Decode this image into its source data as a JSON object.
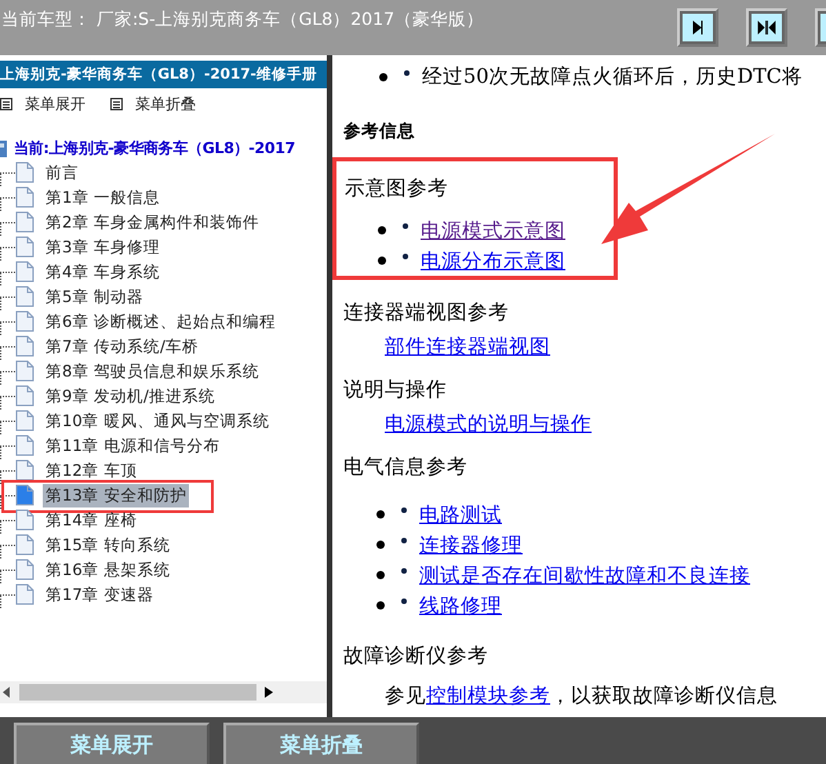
{
  "top_bar": {
    "title": "当前车型：  厂家:S-上海别克商务车（GL8）2017（豪华版）",
    "buttons": [
      {
        "kind": "right"
      },
      {
        "kind": "split"
      },
      {
        "kind": "edge"
      }
    ]
  },
  "sidebar": {
    "title": "上海别克-豪华商务车（GL8）-2017-维修手册",
    "actions": [
      "菜单展开",
      "菜单折叠"
    ],
    "tree": {
      "label": "当前:上海别克-豪华商务车（GL8）-2017",
      "expanded": true,
      "children": [
        {
          "label": "前言",
          "selected": false,
          "highlighted": false
        },
        {
          "label": "第1章 一般信息",
          "selected": false,
          "highlighted": false
        },
        {
          "label": "第2章 车身金属构件和装饰件",
          "selected": false,
          "highlighted": false
        },
        {
          "label": "第3章 车身修理",
          "selected": false,
          "highlighted": false
        },
        {
          "label": "第4章 车身系统",
          "selected": false,
          "highlighted": false
        },
        {
          "label": "第5章 制动器",
          "selected": false,
          "highlighted": false
        },
        {
          "label": "第6章 诊断概述、起始点和编程",
          "selected": false,
          "highlighted": false
        },
        {
          "label": "第7章 传动系统/车桥",
          "selected": false,
          "highlighted": false
        },
        {
          "label": "第8章 驾驶员信息和娱乐系统",
          "selected": false,
          "highlighted": false
        },
        {
          "label": "第9章 发动机/推进系统",
          "selected": false,
          "highlighted": false
        },
        {
          "label": "第10章 暖风、通风与空调系统",
          "selected": false,
          "highlighted": false
        },
        {
          "label": "第11章 电源和信号分布",
          "selected": false,
          "highlighted": false
        },
        {
          "label": "第12章 车顶",
          "selected": false,
          "highlighted": false
        },
        {
          "label": "第13章 安全和防护",
          "selected": true,
          "highlighted": true
        },
        {
          "label": "第14章 座椅",
          "selected": false,
          "highlighted": false
        },
        {
          "label": "第15章 转向系统",
          "selected": false,
          "highlighted": false
        },
        {
          "label": "第16章 悬架系统",
          "selected": false,
          "highlighted": false
        },
        {
          "label": "第17章 变速器",
          "selected": false,
          "highlighted": false
        }
      ]
    }
  },
  "content": {
    "top_bullet": "经过50次无故障点火循环后，历史DTC将",
    "heading": "参考信息",
    "sections": [
      {
        "title": "示意图参考",
        "kind": "bullets",
        "highlighted": true,
        "links": [
          {
            "text": "电源模式示意图",
            "visited": true
          },
          {
            "text": "电源分布示意图",
            "visited": false
          }
        ]
      },
      {
        "title": "连接器端视图参考",
        "kind": "indent",
        "links": [
          {
            "text": "部件连接器端视图",
            "visited": false
          }
        ]
      },
      {
        "title": "说明与操作",
        "kind": "indent",
        "links": [
          {
            "text": "电源模式的说明与操作",
            "visited": false
          }
        ]
      },
      {
        "title": "电气信息参考",
        "kind": "bullets",
        "links": [
          {
            "text": "电路测试",
            "visited": false
          },
          {
            "text": "连接器修理",
            "visited": false
          },
          {
            "text": "测试是否存在间歇性故障和不良连接",
            "visited": false
          },
          {
            "text": "线路修理",
            "visited": false
          }
        ]
      },
      {
        "title": "故障诊断仪参考",
        "kind": "sentence",
        "before": "参见",
        "link": "控制模块参考",
        "after": "，以获取故障诊断仪信息"
      }
    ]
  },
  "bottom_buttons": [
    "菜单展开",
    "菜单折叠"
  ]
}
